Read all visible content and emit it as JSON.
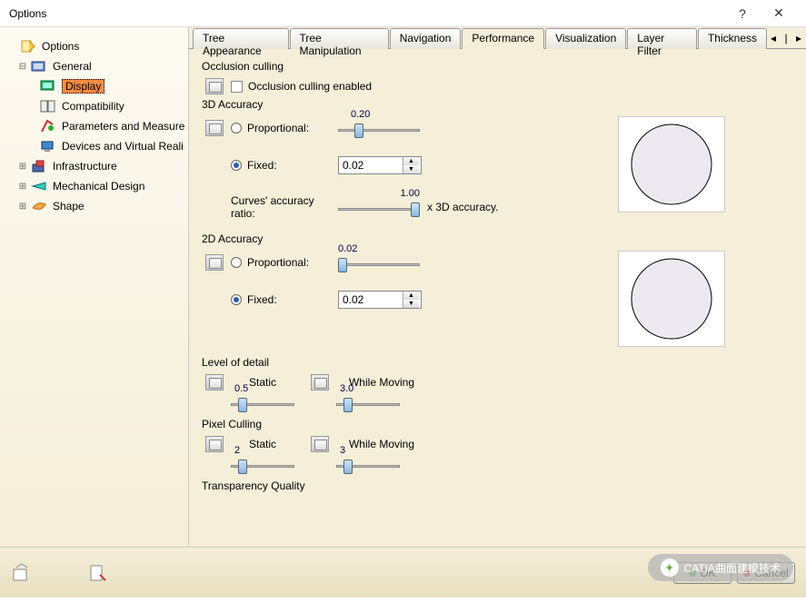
{
  "window": {
    "title": "Options"
  },
  "tree": {
    "root": "Options",
    "general": "General",
    "display": "Display",
    "compatibility": "Compatibility",
    "params": "Parameters and Measure",
    "devices": "Devices and Virtual Reali",
    "infra": "Infrastructure",
    "mechdesign": "Mechanical Design",
    "shape": "Shape"
  },
  "tabs": {
    "t1": "Tree Appearance",
    "t2": "Tree Manipulation",
    "t3": "Navigation",
    "t4": "Performance",
    "t5": "Visualization",
    "t6": "Layer Filter",
    "t7": "Thickness"
  },
  "occlusion": {
    "title": "Occlusion culling",
    "label": "Occlusion culling enabled"
  },
  "acc3d": {
    "title": "3D Accuracy",
    "proportional": "Proportional:",
    "proportional_val": "0.20",
    "fixed": "Fixed:",
    "fixed_val": "0.02",
    "ratio_label": "Curves' accuracy ratio:",
    "ratio_val": "1.00",
    "ratio_suffix": "x 3D accuracy."
  },
  "acc2d": {
    "title": "2D Accuracy",
    "proportional": "Proportional:",
    "proportional_val": "0.02",
    "fixed": "Fixed:",
    "fixed_val": "0.02"
  },
  "lod": {
    "title": "Level of detail",
    "static": "Static",
    "static_val": "0.5",
    "moving": "While Moving",
    "moving_val": "3.0"
  },
  "pixel": {
    "title": "Pixel Culling",
    "static": "Static",
    "static_val": "2",
    "moving": "While Moving",
    "moving_val": "3"
  },
  "transparency": {
    "title": "Transparency Quality"
  },
  "buttons": {
    "ok": "OK",
    "cancel": "Cancel"
  },
  "watermark": "CATIA曲面建模技术"
}
